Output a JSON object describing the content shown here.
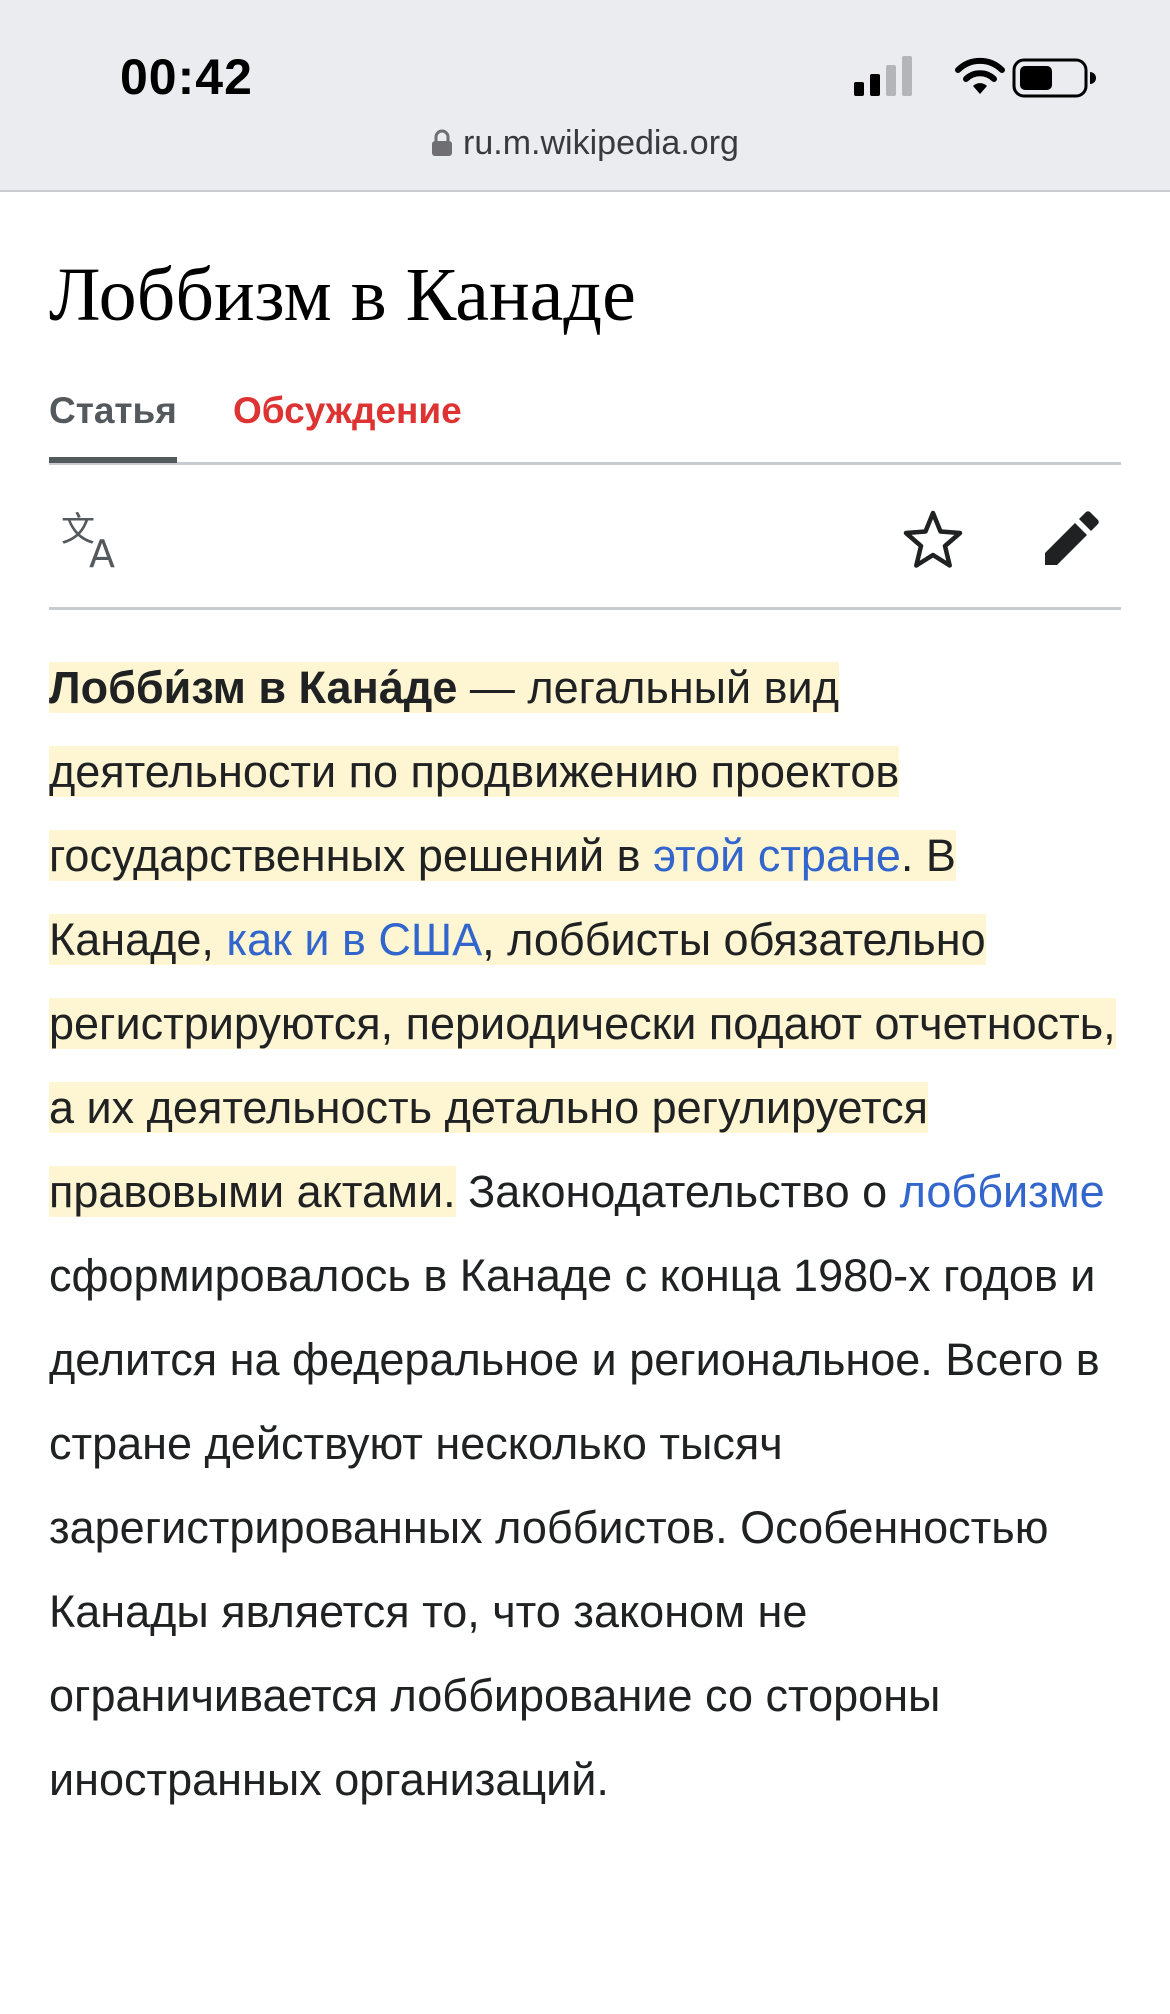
{
  "status_bar": {
    "time": "00:42",
    "icons": [
      "cellular-signal-icon",
      "wifi-icon",
      "battery-icon"
    ],
    "url": "ru.m.wikipedia.org"
  },
  "page": {
    "title": "Лоббизм в Канаде",
    "tabs": [
      {
        "label": "Статья",
        "active": true
      },
      {
        "label": "Обсуждение",
        "active": false
      }
    ],
    "toolbar_icons": [
      "language-translate-icon",
      "watch-star-icon",
      "edit-pencil-icon"
    ]
  },
  "article": {
    "term": "Лобби́зм в Кана́де",
    "p1_a": " — легальный вид деятельности по продвижению проектов государственных решений в ",
    "link_this_country": "этой стране",
    "p1_b": ". В Канаде, ",
    "link_like_usa": "как и в США",
    "p1_c": ", лоббисты обязательно регистрируются, периодически подают отчетность, а их деятельность детально регулируется правовыми актами.",
    "p2_a": " Законодательство о ",
    "link_lobbying": "лоббизме",
    "p2_b": " сформировалось в Канаде с конца 1980-х годов и делится на федеральное и региональное. Всего в стране действуют несколько тысяч зарегистрированных лоббистов. Особенностью Канады является то, что законом не ограничивается лоббирование со стороны иностранных организаций."
  },
  "colors": {
    "link": "#3366cc",
    "talk_tab": "#dd3333",
    "highlight": "#fef6d3",
    "status_bar_bg": "#eaecf0"
  }
}
